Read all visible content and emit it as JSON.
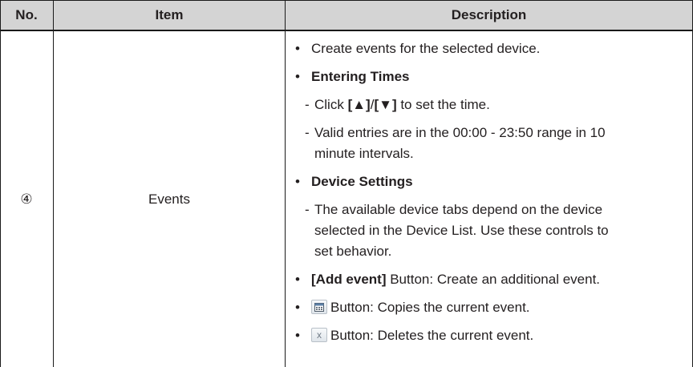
{
  "header": {
    "no": "No.",
    "item": "Item",
    "description": "Description"
  },
  "row": {
    "number": "④",
    "item": "Events",
    "description": {
      "bullet_char": "•",
      "dash_char": "-",
      "b1": "Create events for the selected device.",
      "b2_bold": "Entering Times",
      "d1_pre": "Click ",
      "d1_up": "[▲]",
      "d1_slash": "/",
      "d1_down": "[▼]",
      "d1_post": " to set the time.",
      "d2_line1": "Valid entries are in the 00:00 - 23:50 range in 10",
      "d2_line2": "minute intervals.",
      "b3_bold": "Device Settings",
      "d3_line1": "The available device tabs depend on the device",
      "d3_line2": "selected in the Device List. Use these controls to",
      "d3_line3": "set behavior.",
      "b4_bold": "[Add event]",
      "b4_rest": " Button: Create an additional event.",
      "b5_rest": "Button: Copies the current event.",
      "b6_rest": "Button: Deletes the current event.",
      "b6_icon_glyph": "x"
    }
  },
  "icons": [
    "calendar-copy-icon",
    "delete-x-icon"
  ]
}
